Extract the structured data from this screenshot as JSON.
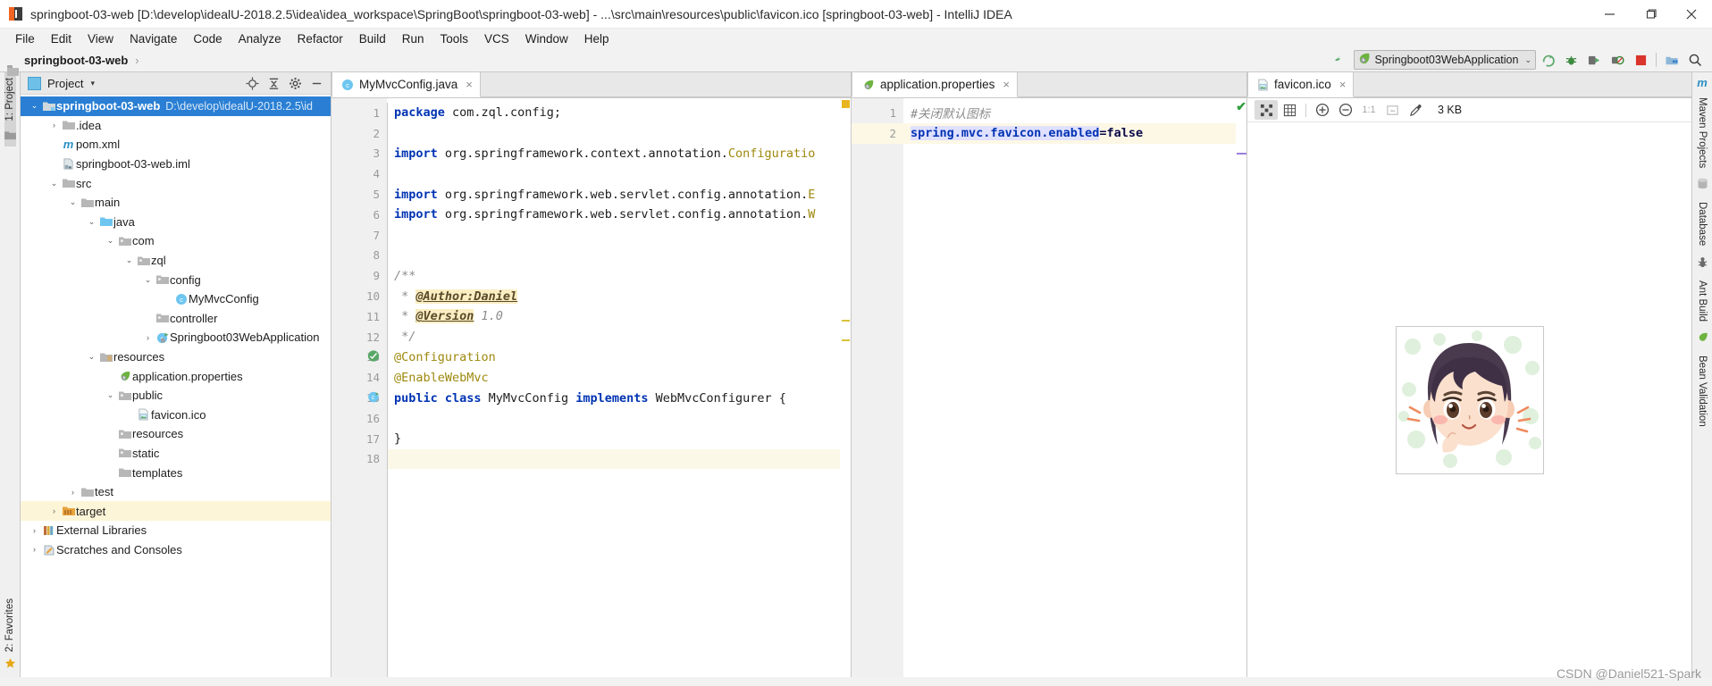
{
  "window": {
    "title": "springboot-03-web [D:\\develop\\idealU-2018.2.5\\idea\\idea_workspace\\SpringBoot\\springboot-03-web] - ...\\src\\main\\resources\\public\\favicon.ico [springboot-03-web] - IntelliJ IDEA",
    "app_icon": "intellij-idea-icon",
    "minimize": "minimize-icon",
    "maximize": "restore-icon",
    "close": "close-icon"
  },
  "menubar": {
    "items": [
      {
        "label": "File"
      },
      {
        "label": "Edit"
      },
      {
        "label": "View"
      },
      {
        "label": "Navigate"
      },
      {
        "label": "Code"
      },
      {
        "label": "Analyze"
      },
      {
        "label": "Refactor"
      },
      {
        "label": "Build"
      },
      {
        "label": "Run"
      },
      {
        "label": "Tools"
      },
      {
        "label": "VCS"
      },
      {
        "label": "Window"
      },
      {
        "label": "Help"
      }
    ]
  },
  "navbar": {
    "breadcrumb": "springboot-03-web",
    "breadcrumb_separator": "›",
    "run_config": "Springboot03WebApplication",
    "run_config_icon": "spring-leaf-icon",
    "run_config_chevron": "⌄",
    "buttons": [
      {
        "name": "make-project-icon"
      },
      {
        "name": "run-icon"
      },
      {
        "name": "debug-icon"
      },
      {
        "name": "run-with-coverage-icon"
      },
      {
        "name": "profile-icon"
      },
      {
        "name": "stop-icon"
      },
      {
        "name": "project-structure-icon"
      },
      {
        "name": "search-everywhere-icon"
      }
    ]
  },
  "left_rail": {
    "top_tab": "1: Project",
    "bottom_tab": "2: Favorites",
    "favorite_icon": "star-icon",
    "module_icon": "folder-icon"
  },
  "project_panel": {
    "title": "Project",
    "title_icon": "project-view-icon",
    "caret": "▾",
    "tools": [
      {
        "name": "locate-icon"
      },
      {
        "name": "collapse-all-icon"
      },
      {
        "name": "settings-gear-icon"
      },
      {
        "name": "hide-panel-icon"
      }
    ],
    "tree": [
      {
        "indent": 0,
        "arrow": "⌄",
        "icon": "module-folder-icon",
        "label": "springboot-03-web",
        "path": "D:\\develop\\idealU-2018.2.5\\id",
        "selected": true,
        "bold": true
      },
      {
        "indent": 1,
        "arrow": "›",
        "icon": "folder-icon",
        "label": "",
        "name": ".idea"
      },
      {
        "indent": 2,
        "arrow": "",
        "icon": "maven-m-icon",
        "label": "",
        "name": "pom.xml"
      },
      {
        "indent": 2,
        "arrow": "",
        "icon": "iml-file-icon",
        "label": "",
        "name": "springboot-03-web.iml"
      },
      {
        "indent": 1,
        "arrow": "⌄",
        "icon": "folder-icon",
        "label": "",
        "name": "src"
      },
      {
        "indent": 2,
        "arrow": "⌄",
        "icon": "folder-icon",
        "label": "",
        "name": "main"
      },
      {
        "indent": 3,
        "arrow": "⌄",
        "icon": "source-folder-icon",
        "label": "",
        "name": "java"
      },
      {
        "indent": 4,
        "arrow": "⌄",
        "icon": "package-icon",
        "label": "",
        "name": "com"
      },
      {
        "indent": 5,
        "arrow": "⌄",
        "icon": "package-icon",
        "label": "",
        "name": "zql"
      },
      {
        "indent": 6,
        "arrow": "⌄",
        "icon": "package-icon",
        "label": "",
        "name": "config"
      },
      {
        "indent": 7,
        "arrow": "",
        "icon": "java-class-icon",
        "label": "",
        "name": "MyMvcConfig"
      },
      {
        "indent": 6,
        "arrow": "",
        "icon": "package-icon",
        "label": "",
        "name": "controller"
      },
      {
        "indent": 6,
        "arrow": "›",
        "icon": "spring-boot-class-icon",
        "label": "",
        "name": "Springboot03WebApplication"
      },
      {
        "indent": 3,
        "arrow": "⌄",
        "icon": "resources-folder-icon",
        "label": "",
        "name": "resources"
      },
      {
        "indent": 4,
        "arrow": "",
        "icon": "spring-properties-icon",
        "label": "",
        "name": "application.properties"
      },
      {
        "indent": 4,
        "arrow": "⌄",
        "icon": "package-icon",
        "label": "",
        "name": "public"
      },
      {
        "indent": 5,
        "arrow": "",
        "icon": "image-file-icon",
        "label": "",
        "name": "favicon.ico"
      },
      {
        "indent": 4,
        "arrow": "",
        "icon": "package-icon",
        "label": "",
        "name": "resources"
      },
      {
        "indent": 4,
        "arrow": "",
        "icon": "package-icon",
        "label": "",
        "name": "static"
      },
      {
        "indent": 4,
        "arrow": "",
        "icon": "folder-icon",
        "label": "",
        "name": "templates"
      },
      {
        "indent": 2,
        "arrow": "›",
        "icon": "folder-icon",
        "label": "",
        "name": "test"
      },
      {
        "indent": 1,
        "arrow": "›",
        "icon": "target-folder-icon",
        "label": "",
        "name": "target",
        "highlight": true
      },
      {
        "indent": 0,
        "arrow": "›",
        "icon": "libraries-icon",
        "label": "",
        "name": "External Libraries"
      },
      {
        "indent": 0,
        "arrow": "›",
        "icon": "scratches-icon",
        "label": "",
        "name": "Scratches and Consoles"
      }
    ]
  },
  "editor_java": {
    "tab": {
      "label": "MyMvcConfig.java",
      "icon": "java-class-icon",
      "close": "×"
    },
    "lines": [
      {
        "n": 1,
        "tokens": [
          {
            "t": "package ",
            "c": "kw"
          },
          {
            "t": "com.zql.config;",
            "c": "cls"
          }
        ]
      },
      {
        "n": 2,
        "tokens": []
      },
      {
        "n": 3,
        "fold": "minus",
        "tokens": [
          {
            "t": "import ",
            "c": "kw"
          },
          {
            "t": "org.springframework.context.annotation.",
            "c": "cls"
          },
          {
            "t": "Configuratio",
            "c": "anno"
          }
        ]
      },
      {
        "n": 4,
        "tokens": []
      },
      {
        "n": 5,
        "tokens": [
          {
            "t": "import ",
            "c": "kw"
          },
          {
            "t": "org.springframework.web.servlet.config.annotation.",
            "c": "cls"
          },
          {
            "t": "E",
            "c": "anno"
          }
        ]
      },
      {
        "n": 6,
        "fold": "minus",
        "tokens": [
          {
            "t": "import ",
            "c": "kw"
          },
          {
            "t": "org.springframework.web.servlet.config.annotation.",
            "c": "cls"
          },
          {
            "t": "W",
            "c": "anno"
          }
        ]
      },
      {
        "n": 7,
        "tokens": []
      },
      {
        "n": 8,
        "tokens": []
      },
      {
        "n": 9,
        "fold": "minus",
        "tokens": [
          {
            "t": "/**",
            "c": "cmt"
          }
        ]
      },
      {
        "n": 10,
        "tokens": [
          {
            "t": " * ",
            "c": "cmt"
          },
          {
            "t": "@Author:Daniel",
            "c": "docmark"
          }
        ]
      },
      {
        "n": 11,
        "tokens": [
          {
            "t": " * ",
            "c": "cmt"
          },
          {
            "t": "@Version",
            "c": "docmark"
          },
          {
            "t": " 1.0",
            "c": "docval"
          }
        ]
      },
      {
        "n": 12,
        "fold": "end",
        "tokens": [
          {
            "t": " */",
            "c": "cmt"
          }
        ]
      },
      {
        "n": 13,
        "fold": "minus",
        "gutter_icon": "spring-bean-icon",
        "tokens": [
          {
            "t": "@Configuration",
            "c": "anno"
          }
        ]
      },
      {
        "n": 14,
        "fold": "end",
        "tokens": [
          {
            "t": "@EnableWebMvc",
            "c": "anno"
          }
        ]
      },
      {
        "n": 15,
        "gutter_icon": "spring-config-icon",
        "tokens": [
          {
            "t": "public class ",
            "c": "kw"
          },
          {
            "t": "MyMvcConfig ",
            "c": "cls"
          },
          {
            "t": "implements ",
            "c": "kw"
          },
          {
            "t": "WebMvcConfigurer {",
            "c": "cls"
          }
        ]
      },
      {
        "n": 16,
        "tokens": []
      },
      {
        "n": 17,
        "tokens": [
          {
            "t": "}",
            "c": "cls"
          }
        ]
      },
      {
        "n": 18,
        "tokens": [],
        "highlight": true
      }
    ],
    "marker_color": "#e8b51f"
  },
  "editor_properties": {
    "tab": {
      "label": "application.properties",
      "icon": "spring-properties-icon",
      "close": "×"
    },
    "inspection_status": "✔",
    "lines": [
      {
        "n": 1,
        "comment": "#关闭默认图标"
      },
      {
        "n": 2,
        "key": "spring.mvc.favicon.enabled",
        "eq": "=",
        "value": "false",
        "highlight": true
      }
    ]
  },
  "editor_image": {
    "tab": {
      "label": "favicon.ico",
      "icon": "image-file-icon",
      "close": "×"
    },
    "toolbar": [
      {
        "name": "transparency-chessboard-icon",
        "active": true
      },
      {
        "name": "grid-icon",
        "active": false
      },
      {
        "name": "zoom-in-icon",
        "active": false
      },
      {
        "name": "zoom-out-icon",
        "active": false
      },
      {
        "name": "actual-size-icon",
        "label": "1:1",
        "active": false
      },
      {
        "name": "fit-to-window-icon",
        "active": false
      },
      {
        "name": "color-picker-icon",
        "active": false
      }
    ],
    "file_size": "3 KB",
    "image_alt": "anime-girl-avatar"
  },
  "right_rail": {
    "tabs": [
      "Maven Projects",
      "Database",
      "Ant Build",
      "Bean Validation"
    ]
  },
  "watermark": "CSDN @Daniel521-Spark",
  "colors": {
    "accent": "#2a7fd4",
    "keyword": "#0033b3",
    "annotation": "#9e880d",
    "comment": "#8c8c8c",
    "selection": "#2a7fd4",
    "highlight": "#fdf5d8",
    "spring_green": "#6db33f"
  }
}
